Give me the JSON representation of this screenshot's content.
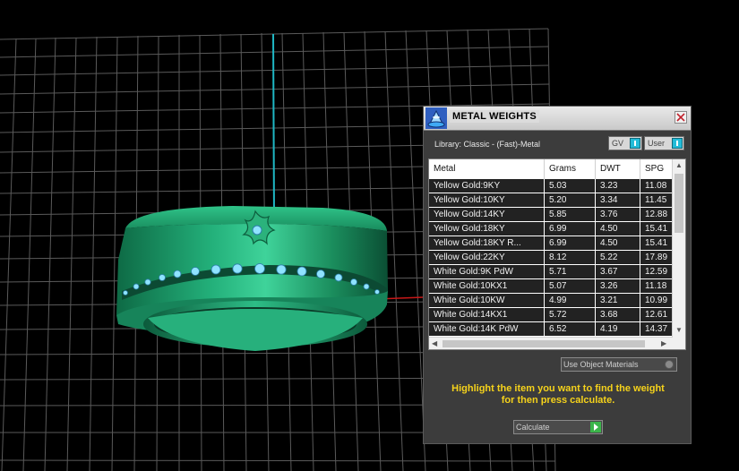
{
  "window": {
    "title": "METAL WEIGHTS"
  },
  "library": {
    "label": "Library: Classic - (Fast)-Metal"
  },
  "toggles": {
    "gv": "GV",
    "user": "User"
  },
  "table": {
    "headers": [
      "Metal",
      "Grams",
      "DWT",
      "SPG"
    ],
    "rows": [
      [
        "Yellow Gold:9KY",
        "5.03",
        "3.23",
        "11.08"
      ],
      [
        "Yellow Gold:10KY",
        "5.20",
        "3.34",
        "11.45"
      ],
      [
        "Yellow Gold:14KY",
        "5.85",
        "3.76",
        "12.88"
      ],
      [
        "Yellow Gold:18KY",
        "6.99",
        "4.50",
        "15.41"
      ],
      [
        "Yellow Gold:18KY R...",
        "6.99",
        "4.50",
        "15.41"
      ],
      [
        "Yellow Gold:22KY",
        "8.12",
        "5.22",
        "17.89"
      ],
      [
        "White Gold:9K PdW",
        "5.71",
        "3.67",
        "12.59"
      ],
      [
        "White Gold:10KX1",
        "5.07",
        "3.26",
        "11.18"
      ],
      [
        "White Gold:10KW",
        "4.99",
        "3.21",
        "10.99"
      ],
      [
        "White Gold:14KX1",
        "5.72",
        "3.68",
        "12.61"
      ],
      [
        "White Gold:14K PdW",
        "6.52",
        "4.19",
        "14.37"
      ]
    ]
  },
  "use_object_materials": {
    "label": "Use Object Materials"
  },
  "hint": {
    "line1": "Highlight the item you want to find the weight",
    "line2": "for then press calculate."
  },
  "calculate": {
    "label": "Calculate"
  },
  "colors": {
    "ring": "#1fa36e",
    "hint": "#f5d21b",
    "accent": "#22bcd8"
  }
}
